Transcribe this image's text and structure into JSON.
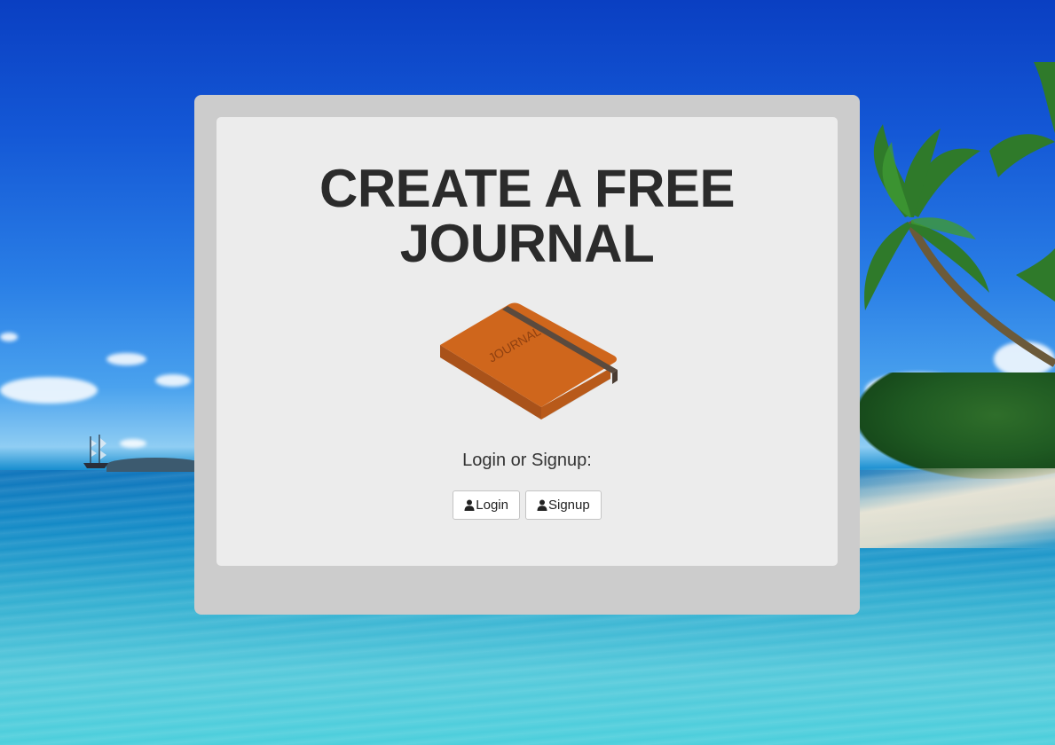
{
  "card": {
    "title_line1": "CREATE A FREE",
    "title_line2": "JOURNAL",
    "illustration": {
      "icon": "journal-book-icon",
      "cover_text": "JOURNAL",
      "cover_color": "#cf661c",
      "band_color": "#5a4a3e"
    },
    "prompt": "Login or Signup:",
    "buttons": {
      "login": {
        "label": "Login",
        "icon": "user-icon"
      },
      "signup": {
        "label": "Signup",
        "icon": "user-icon"
      }
    }
  },
  "colors": {
    "panel_outer": "#cccccc",
    "panel_inner": "#ececec",
    "title_text": "#2b2b2b"
  }
}
